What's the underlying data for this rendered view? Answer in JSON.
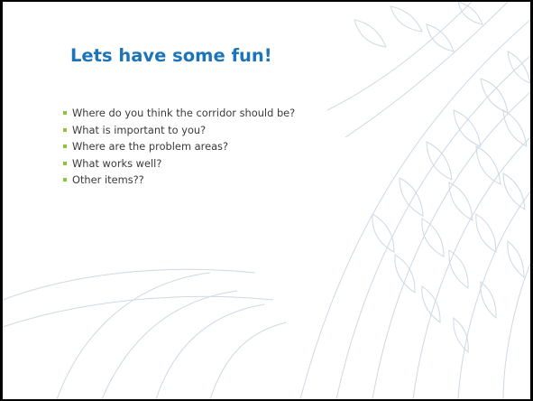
{
  "slide": {
    "title": "Lets have some fun!",
    "bullets": [
      "Where do you think the corridor should be?",
      "What is important to you?",
      "Where are the problem areas?",
      "What works well?",
      "Other items??"
    ]
  },
  "colors": {
    "title": "#1b75b8",
    "bullet_marker": "#8cc63f",
    "body_text": "#3a3a3a",
    "background_art": "#c9d6e2"
  }
}
